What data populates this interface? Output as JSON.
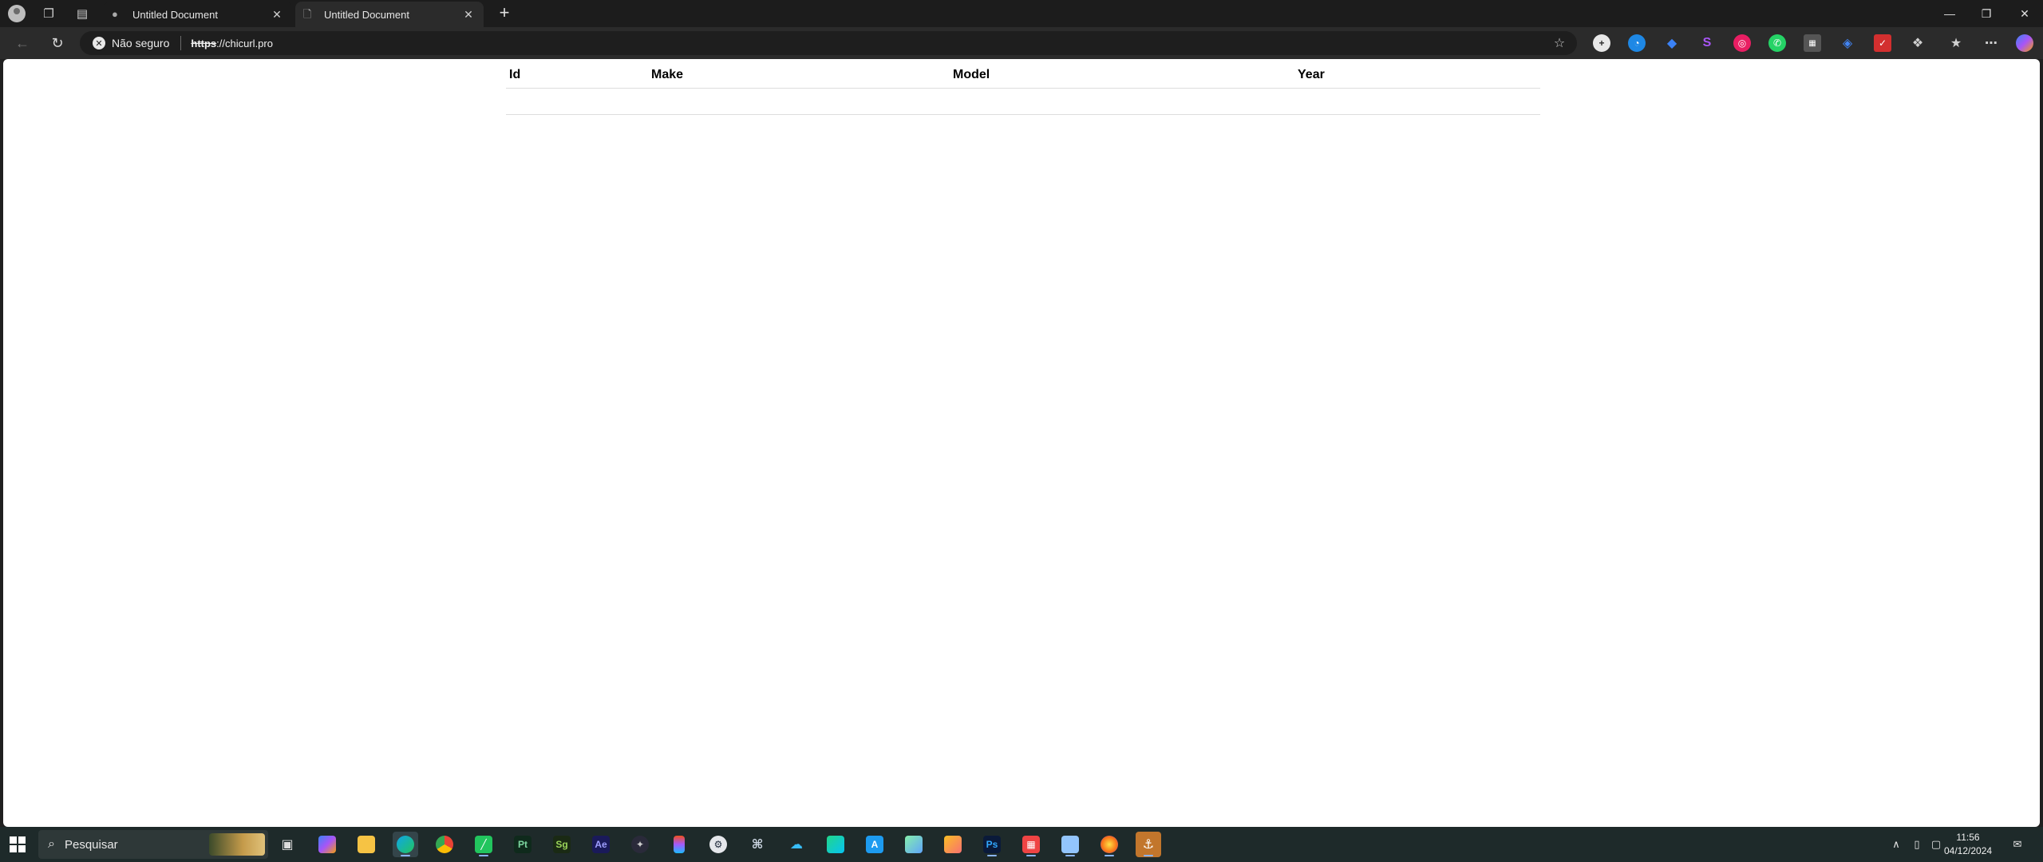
{
  "tabs": [
    {
      "title": "Untitled Document",
      "active": false
    },
    {
      "title": "Untitled Document",
      "active": true
    }
  ],
  "address_bar": {
    "security_label": "Não seguro",
    "url_scheme": "https",
    "url_rest": "://chicurl.pro"
  },
  "table": {
    "headers": [
      "Id",
      "Make",
      "Model",
      "Year"
    ]
  },
  "taskbar": {
    "search_placeholder": "Pesquisar",
    "apps": [
      {
        "label": "Pt",
        "color": "#0f2a1c",
        "fg": "#7cd6a0"
      },
      {
        "label": "Sg",
        "color": "#1a2a14",
        "fg": "#9ad45a"
      },
      {
        "label": "Ae",
        "color": "#1a1a5a",
        "fg": "#9f9fff"
      },
      {
        "label": "Ps",
        "color": "#0a1a3a",
        "fg": "#31a8ff"
      }
    ],
    "time": "11:56",
    "date": "04/12/2024"
  },
  "colors": {
    "accent": "#8ab4f8",
    "page_bg": "#ffffff",
    "chrome_bg": "#2b2b2b"
  }
}
